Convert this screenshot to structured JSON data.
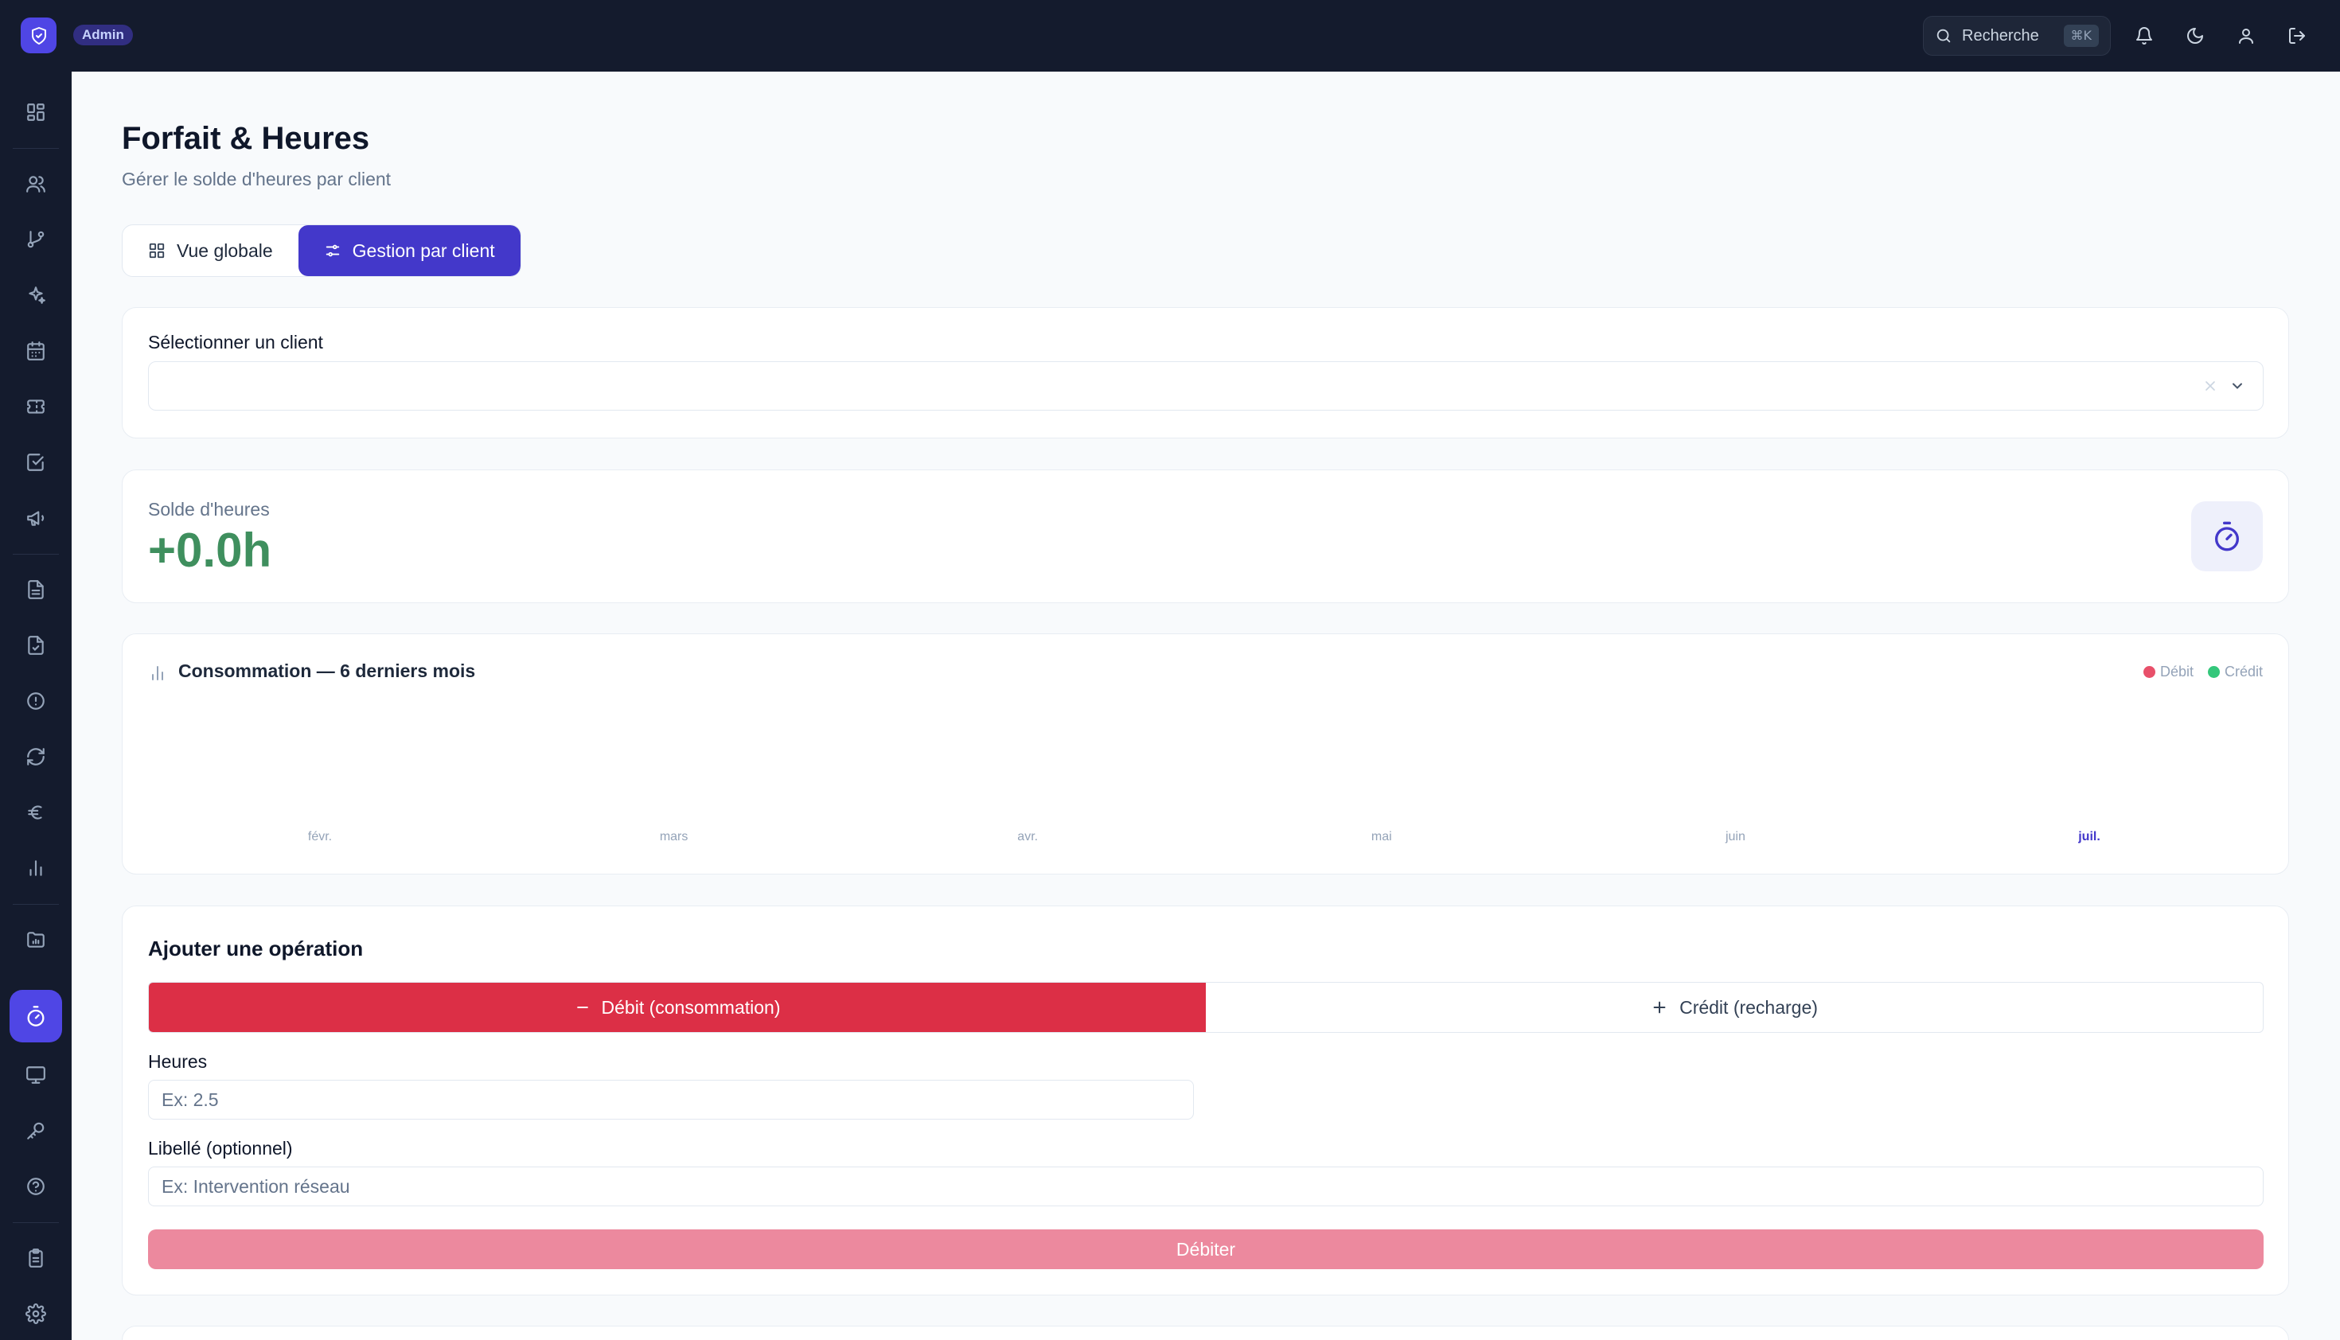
{
  "topbar": {
    "badge": "Admin",
    "search_label": "Recherche",
    "search_shortcut": "⌘K"
  },
  "sidebar": {
    "items": [
      "dashboard-icon",
      "users-icon",
      "git-branch-icon",
      "sparkles-icon",
      "calendar-icon",
      "ticket-icon",
      "checkbox-icon",
      "megaphone-icon",
      "file-text-icon",
      "file-check-icon",
      "alert-circle-icon",
      "refresh-icon",
      "euro-icon",
      "bar-chart-icon",
      "folder-chart-icon",
      "timer-icon",
      "monitor-icon",
      "key-icon",
      "help-circle-icon",
      "clipboard-icon",
      "settings-icon"
    ],
    "active": "timer-icon"
  },
  "page": {
    "title": "Forfait & Heures",
    "subtitle": "Gérer le solde d'heures par client"
  },
  "tabs": [
    {
      "label": "Vue globale",
      "active": false
    },
    {
      "label": "Gestion par client",
      "active": true
    }
  ],
  "client_select": {
    "label": "Sélectionner un client",
    "value": ""
  },
  "balance": {
    "label": "Solde d'heures",
    "value": "+0.0h"
  },
  "consumption": {
    "title": "Consommation — 6 derniers mois",
    "legend": [
      {
        "label": "Débit",
        "color": "#e8506a"
      },
      {
        "label": "Crédit",
        "color": "#34c77b"
      }
    ],
    "months": [
      "févr.",
      "mars",
      "avr.",
      "mai",
      "juin",
      "juil."
    ],
    "current_month_index": 5
  },
  "operation": {
    "title": "Ajouter une opération",
    "debit_label": "Débit (consommation)",
    "credit_label": "Crédit (recharge)",
    "hours_label": "Heures",
    "hours_placeholder": "Ex: 2.5",
    "desc_label": "Libellé (optionnel)",
    "desc_placeholder": "Ex: Intervention réseau",
    "submit_label": "Débiter"
  },
  "colors": {
    "accent": "#4338ca",
    "debit": "#dc2f46",
    "positive": "#3f8f5e"
  }
}
